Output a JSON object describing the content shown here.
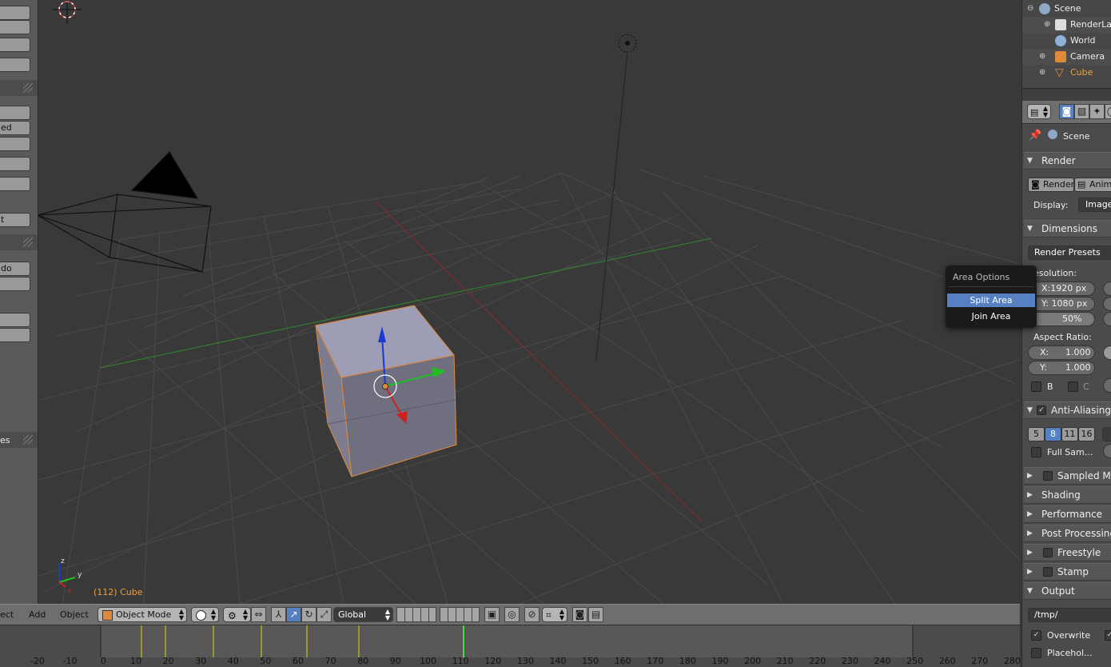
{
  "viewport": {
    "object_label": "(112) Cube",
    "axis_labels": {
      "x": "x",
      "y": "y",
      "z": "z"
    }
  },
  "tool_shelf": {
    "partial_labels": [
      "ed",
      "t",
      "do",
      "es"
    ]
  },
  "header": {
    "menus": [
      "ect",
      "Add",
      "Object"
    ],
    "mode": "Object Mode",
    "orientation": "Global"
  },
  "timeline": {
    "ticks": [
      "-20",
      "-10",
      "0",
      "10",
      "20",
      "30",
      "40",
      "50",
      "60",
      "70",
      "80",
      "90",
      "100",
      "110",
      "120",
      "130",
      "140",
      "150",
      "160",
      "170",
      "180",
      "190",
      "200",
      "210",
      "220",
      "230",
      "240",
      "250",
      "260",
      "270",
      "280"
    ],
    "current_frame": 112
  },
  "outliner": {
    "items": [
      {
        "label": "Scene",
        "icon": "scene-icon"
      },
      {
        "label": "RenderLay",
        "icon": "render-layer-icon"
      },
      {
        "label": "World",
        "icon": "world-icon"
      },
      {
        "label": "Camera",
        "icon": "camera-icon"
      },
      {
        "label": "Cube",
        "icon": "mesh-icon"
      }
    ]
  },
  "properties": {
    "context": "Scene",
    "render_panel": "Render",
    "render_button": "Render",
    "animation_button": "Anima",
    "display_label": "Display:",
    "display_value": "Image",
    "dimensions_panel": "Dimensions",
    "render_presets": "Render Presets",
    "resolution_label": "esolution:",
    "res_x": "X:1920 px",
    "res_y": "Y: 1080 px",
    "res_pct": "50%",
    "aspect_label": "Aspect Ratio:",
    "aspect_x_label": "X:",
    "aspect_x": "1.000",
    "aspect_y_label": "Y:",
    "aspect_y": "1.000",
    "border_label": "B",
    "crop_label": "C",
    "anti_aliasing": "Anti-Aliasing",
    "aa_samples": [
      "5",
      "8",
      "11",
      "16"
    ],
    "aa_selected": "8",
    "full_sample": "Full Sam...",
    "panels": [
      "Sampled Mo",
      "Shading",
      "Performance",
      "Post Processing",
      "Freestyle",
      "Stamp"
    ],
    "output_panel": "Output",
    "output_path": "/tmp/",
    "overwrite": "Overwrite",
    "placeholders": "Placehol..."
  },
  "popup": {
    "title": "Area Options",
    "items": [
      "Split Area",
      "Join Area"
    ],
    "selected": "Split Area"
  },
  "colors": {
    "accent": "#5680c2",
    "object_label": "#f0a040",
    "selection_outline": "#e08a3c"
  }
}
